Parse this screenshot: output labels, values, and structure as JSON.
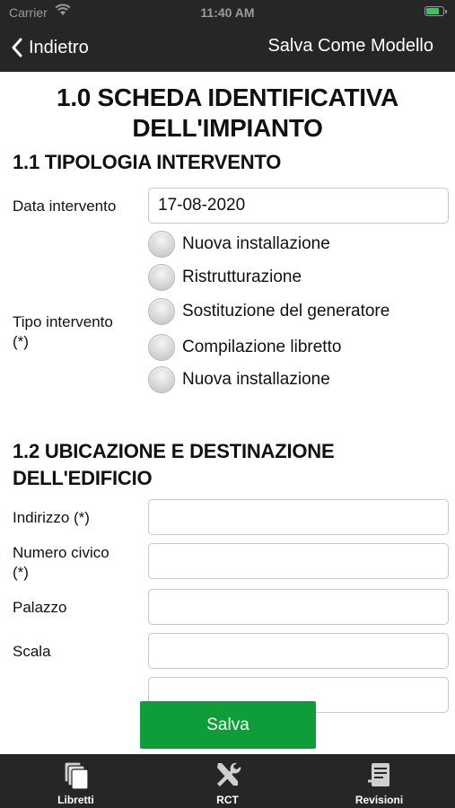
{
  "status": {
    "carrier": "Carrier",
    "time": "11:40 AM",
    "battery_level": 0.8
  },
  "nav": {
    "back_label": "Indietro",
    "right_action": "Salva Come Modello"
  },
  "form": {
    "title_line1": "1.0 SCHEDA IDENTIFICATIVA",
    "title_line2": "DELL'IMPIANTO",
    "section1": {
      "heading": "1.1 TIPOLOGIA INTERVENTO",
      "date_label": "Data intervento",
      "date_value": "17-08-2020",
      "type_label_line1": "Tipo intervento",
      "type_label_line2": "(*)",
      "type_options": [
        "Nuova installazione",
        "Ristrutturazione",
        "Sostituzione del generatore",
        "Compilazione libretto",
        "Nuova installazione"
      ]
    },
    "section2": {
      "heading_line1": "1.2 UBICAZIONE E DESTINAZIONE",
      "heading_line2": "DELL'EDIFICIO",
      "address_label": "Indirizzo (*)",
      "address_value": "",
      "civic_label_line1": "Numero civico",
      "civic_label_line2": "(*)",
      "civic_value": "",
      "building_label": "Palazzo",
      "building_value": "",
      "stair_label": "Scala",
      "stair_value": ""
    },
    "save_label": "Salva"
  },
  "tabs": [
    {
      "label": "Libretti",
      "icon": "booklets-icon"
    },
    {
      "label": "RCT",
      "icon": "tools-icon"
    },
    {
      "label": "Revisioni",
      "icon": "revisions-icon"
    }
  ],
  "colors": {
    "bar": "#262626",
    "save_button": "#0f9d3a",
    "battery": "#35c759"
  }
}
